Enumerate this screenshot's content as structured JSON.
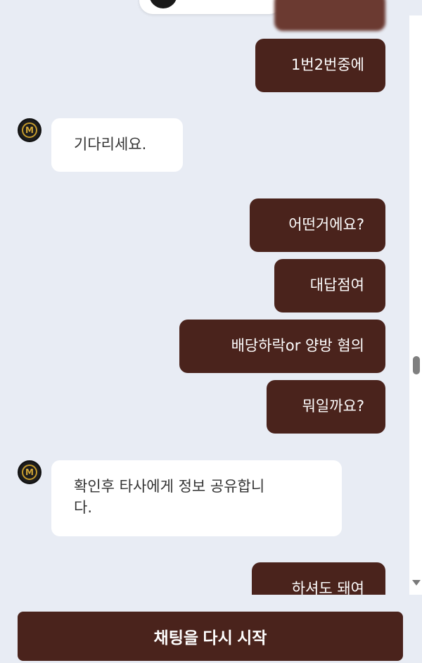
{
  "messages": [
    {
      "role": "user",
      "text": "1번2번중에"
    },
    {
      "role": "bot",
      "text": "기다리세요."
    },
    {
      "role": "user",
      "text": "어떤거에요?"
    },
    {
      "role": "user",
      "text": "대답점여"
    },
    {
      "role": "user",
      "text": "배당하락or 양방 혐의"
    },
    {
      "role": "user",
      "text": "뭐일까요?"
    },
    {
      "role": "bot",
      "text_line1": "확인후 타사에게 정보 공유합니",
      "text_line2": "다."
    },
    {
      "role": "user",
      "text": "하셔도 돼여"
    }
  ],
  "avatar_icon": "m-logo-icon",
  "restart_button_label": "채팅을 다시 시작",
  "colors": {
    "user_bubble": "#4a231c",
    "bot_bubble": "#ffffff",
    "background": "#e8ecf4",
    "avatar_gold": "#c49a2c"
  }
}
